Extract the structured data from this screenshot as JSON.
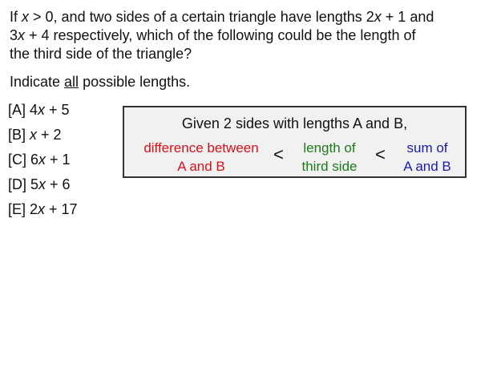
{
  "question": {
    "l1": {
      "a": "If ",
      "b": "x",
      "c": " > 0, and two sides of a certain triangle have lengths 2",
      "d": "x",
      "e": " + 1 and"
    },
    "l2": {
      "a": "3",
      "b": "x",
      "c": " + 4 respectively, which of the following could be the length of"
    },
    "l3": "the third side of the triangle?"
  },
  "instruction": {
    "before": "Indicate ",
    "underlined": "all",
    "after": " possible lengths."
  },
  "choices": [
    {
      "label": "[A] 4",
      "var": "x",
      "rest": " + 5"
    },
    {
      "label": "[B] ",
      "var": "x",
      "rest": " + 2"
    },
    {
      "label": "[C] 6",
      "var": "x",
      "rest": " + 1"
    },
    {
      "label": "[D] 5",
      "var": "x",
      "rest": " + 6"
    },
    {
      "label": "[E] 2",
      "var": "x",
      "rest": " + 17"
    }
  ],
  "rule_box": {
    "title": "Given 2 sides with lengths A and B,",
    "difference": {
      "line1": "difference between",
      "line2": "A and B"
    },
    "length": {
      "line1": "length of",
      "line2": "third side"
    },
    "sum": {
      "line1": "sum of",
      "line2": "A and B"
    },
    "less_than": "<"
  },
  "colors": {
    "difference": "#d6101a",
    "length": "#1c7a1c",
    "sum": "#1a1aa8",
    "box_background": "#f1f1f1"
  }
}
